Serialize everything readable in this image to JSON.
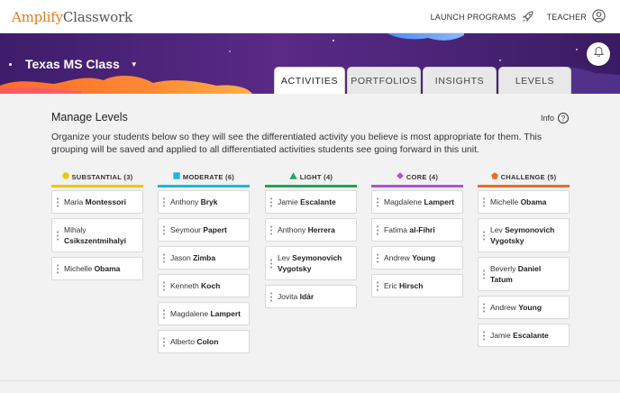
{
  "app": {
    "logo_a": "Amplify",
    "logo_b": "Classwork"
  },
  "topbar": {
    "launch_label": "LAUNCH PROGRAMS",
    "user_label": "TEACHER"
  },
  "banner": {
    "class_name": "Texas MS Class"
  },
  "tabs": [
    {
      "label": "ACTIVITIES",
      "active": true
    },
    {
      "label": "PORTFOLIOS"
    },
    {
      "label": "INSIGHTS"
    },
    {
      "label": "LEVELS"
    }
  ],
  "main": {
    "heading": "Manage Levels",
    "info_label": "Info",
    "info_glyph": "?",
    "description": "Organize your students below so they will see the differentiated activity you believe is most appropriate for them. This grouping will be saved and applied to all differentiated activities students see going forward in this unit."
  },
  "levels": [
    {
      "label": "SUBSTANTIAL (3)",
      "color": "#f2c500",
      "icon": "circle-icon",
      "students": [
        {
          "first": "Maria",
          "last": "Montessori"
        },
        {
          "first": "Mihaly",
          "last": "Csikszentmihalyi"
        },
        {
          "first": "Michelle",
          "last": "Obama"
        }
      ]
    },
    {
      "label": "MODERATE (6)",
      "color": "#1fb6e0",
      "icon": "square-icon",
      "students": [
        {
          "first": "Anthony",
          "last": "Bryk"
        },
        {
          "first": "Seymour",
          "last": "Papert"
        },
        {
          "first": "Jason",
          "last": "Zimba"
        },
        {
          "first": "Kenneth",
          "last": "Koch"
        },
        {
          "first": "Magdalene",
          "last": "Lampert"
        },
        {
          "first": "Alberto",
          "last": "Colon"
        }
      ]
    },
    {
      "label": "LIGHT (4)",
      "color": "#23a455",
      "icon": "triangle-icon",
      "students": [
        {
          "first": "Jamie",
          "last": "Escalante"
        },
        {
          "first": "Anthony",
          "last": "Herrera"
        },
        {
          "first": "Lev",
          "last": "Seymonovich Vygotsky"
        },
        {
          "first": "Jovita",
          "last": "Idár"
        }
      ]
    },
    {
      "label": "CORE (4)",
      "color": "#b44fd6",
      "icon": "diamond-icon",
      "students": [
        {
          "first": "Magdalene",
          "last": "Lampert"
        },
        {
          "first": "Fatima",
          "last": "al-Fihri"
        },
        {
          "first": "Andrew",
          "last": "Young"
        },
        {
          "first": "Eric",
          "last": "Hirsch"
        }
      ]
    },
    {
      "label": "CHALLENGE (5)",
      "color": "#ea6a2a",
      "icon": "pentagon-icon",
      "students": [
        {
          "first": "Michelle",
          "last": "Obama"
        },
        {
          "first": "Lev",
          "last": "Seymonovich Vygotsky"
        },
        {
          "first": "Beverly",
          "last": "Daniel Tatum"
        },
        {
          "first": "Andrew",
          "last": "Young"
        },
        {
          "first": "Jamie",
          "last": "Escalante"
        }
      ]
    }
  ]
}
